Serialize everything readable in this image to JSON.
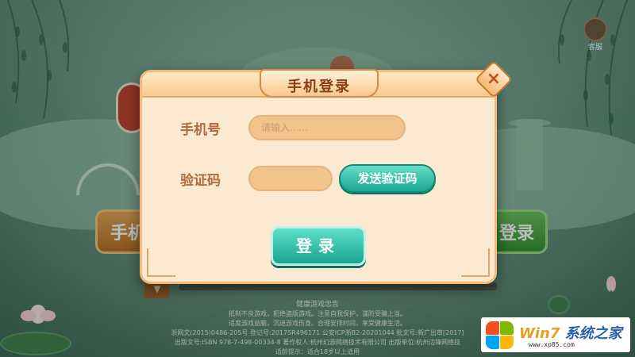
{
  "background": {
    "seal_text": "",
    "left_button_label": "手机",
    "right_button_label": "登录",
    "avatar_label": "客服"
  },
  "footer": {
    "title": "健康游戏忠告",
    "line1": "抵制不良游戏，拒绝盗版游戏。注意自我保护，谨防受骗上当。",
    "line2": "适度游戏益脑，沉迷游戏伤身。合理安排时间，享受健康生活。",
    "line3": "浙网文(2015)0486-205号   登记号:2017SR496171   公安ICP浙B2-20201044   批文号:新广出审[2017]",
    "line4": "出版文号:ISBN 978-7-498-00334-8   著作权人:杭州幻游网络技术有限公司   出版单位:杭州边锋网络技",
    "line5": "适龄提示：适合18岁以上适用"
  },
  "dialog": {
    "title": "手机登录",
    "close_icon": "×",
    "phone_label": "手机号",
    "phone_placeholder": "请输入......",
    "code_label": "验证码",
    "code_value": "",
    "send_code_label": "发送验证码",
    "login_label": "登录"
  },
  "watermark": {
    "brand_main": "Win7",
    "brand_tail": "系统之家",
    "url": "www.xp85.com"
  },
  "colors": {
    "accent_teal": "#1aa894",
    "dialog_bg": "#fbe9d2",
    "label_brown": "#b26a3c"
  }
}
